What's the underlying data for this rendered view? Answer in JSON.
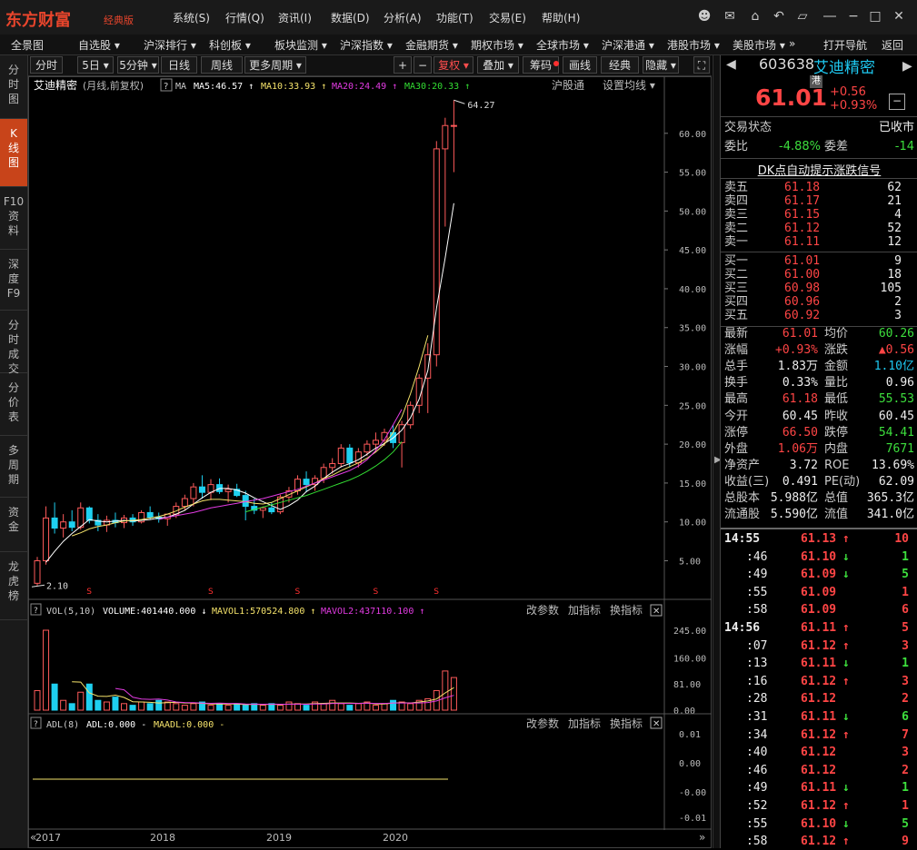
{
  "app": {
    "logo": "东方财富",
    "edition": "经典版",
    "menus": [
      "系统(S)",
      "行情(Q)",
      "资讯(I)",
      "数据(D)",
      "分析(A)",
      "功能(T)",
      "交易(E)",
      "帮助(H)"
    ]
  },
  "nav": {
    "items": [
      "全景图",
      "自选股 ▾",
      "沪深排行 ▾",
      "科创板 ▾",
      "板块监测 ▾",
      "沪深指数 ▾",
      "金融期货 ▾",
      "期权市场 ▾",
      "全球市场 ▾",
      "沪深港通 ▾",
      "港股市场 ▾",
      "美股市场 ▾",
      "»"
    ],
    "right": [
      "打开导航",
      "返回"
    ]
  },
  "left_tabs": [
    "分\n时\n图",
    "K\n线\n图",
    "F10\n资\n料",
    "深\n度\nF9",
    "分\n时\n成\n交",
    "分\n价\n表",
    "多\n周\n期",
    "资\n金",
    "龙\n虎\n榜"
  ],
  "toolbar": {
    "periods": [
      "分时",
      "5日 ▾",
      "5分钟 ▾",
      "日线",
      "周线",
      "更多周期 ▾"
    ],
    "right": [
      "+",
      "−",
      "复权 ▾",
      "叠加 ▾",
      "筹码",
      "画线",
      "经典",
      "隐藏 ▾",
      "⛶"
    ]
  },
  "chart_info": {
    "name": "艾迪精密",
    "mode": "(月线,前复权)",
    "help": "?",
    "ma_label": "MA",
    "ma5": "MA5:46.57",
    "ma10": "MA10:33.93",
    "ma20": "MA20:24.49",
    "ma30": "MA30:20.33",
    "tag": "沪股通",
    "setting": "设置均线 ▾",
    "high_mark": "64.27",
    "low_mark": "2.10",
    "vol_label": "VOL(5,10)",
    "volume": "VOLUME:401440.000",
    "mavol1": "MAVOL1:570524.800",
    "mavol2": "MAVOL2:437110.100",
    "adl_label": "ADL(8)",
    "adl": "ADL:0.000",
    "maadl": "MAADL:0.000",
    "panel_btns": [
      "改参数",
      "加指标",
      "换指标"
    ],
    "x_labels": [
      "2017",
      "2018",
      "2019",
      "2020"
    ],
    "nav_left": "«",
    "nav_right": "»"
  },
  "chart_data": {
    "type": "candlestick",
    "price_ticks": [
      60.0,
      55.0,
      50.0,
      45.0,
      40.0,
      35.0,
      30.0,
      25.0,
      20.0,
      15.0,
      10.0,
      5.0
    ],
    "price_tick_labels": [
      "60.00",
      "55.00",
      "50.00",
      "45.00",
      "40.00",
      "35.00",
      "30.00",
      "25.00",
      "20.00",
      "15.00",
      "10.00",
      "5.00"
    ],
    "ylim": [
      0.5,
      65
    ],
    "candles": [
      [
        2.1,
        5.5,
        1.8,
        5.0
      ],
      [
        5.0,
        12,
        4.5,
        10.5
      ],
      [
        10.5,
        12.5,
        8.5,
        9.2
      ],
      [
        9.2,
        11,
        8.0,
        10.0
      ],
      [
        10.0,
        11.5,
        8.8,
        9.3
      ],
      [
        9.3,
        12.5,
        9.0,
        11.8
      ],
      [
        11.8,
        12.0,
        9.8,
        10.2
      ],
      [
        10.2,
        11.0,
        8.8,
        9.6
      ],
      [
        9.6,
        10.8,
        8.7,
        10.2
      ],
      [
        10.2,
        11.2,
        9.3,
        9.9
      ],
      [
        9.9,
        10.9,
        9.2,
        10.5
      ],
      [
        10.5,
        11.0,
        9.5,
        10.0
      ],
      [
        10.0,
        11.5,
        9.8,
        11.2
      ],
      [
        11.2,
        12.0,
        10.3,
        10.6
      ],
      [
        10.6,
        11.2,
        9.9,
        10.4
      ],
      [
        10.4,
        11.0,
        9.5,
        11.0
      ],
      [
        11.0,
        12.5,
        10.5,
        12.0
      ],
      [
        12.0,
        13.5,
        11.5,
        13.0
      ],
      [
        13.0,
        15.0,
        12.0,
        14.5
      ],
      [
        14.5,
        16.0,
        13.0,
        13.8
      ],
      [
        13.8,
        15.5,
        12.8,
        14.8
      ],
      [
        14.8,
        15.6,
        13.6,
        13.9
      ],
      [
        13.9,
        14.8,
        12.5,
        14.2
      ],
      [
        14.2,
        14.9,
        13.2,
        13.4
      ],
      [
        13.4,
        14.0,
        10.2,
        12.0
      ],
      [
        12.0,
        13.0,
        11.0,
        11.5
      ],
      [
        11.5,
        12.0,
        10.5,
        11.8
      ],
      [
        11.8,
        12.5,
        11.0,
        11.3
      ],
      [
        11.3,
        13.5,
        11.0,
        13.2
      ],
      [
        13.2,
        14.5,
        12.5,
        14.0
      ],
      [
        14.0,
        16.0,
        13.5,
        15.5
      ],
      [
        15.5,
        16.5,
        13.8,
        14.8
      ],
      [
        14.8,
        16.0,
        14.0,
        15.6
      ],
      [
        15.6,
        17.5,
        15.0,
        17.0
      ],
      [
        17.0,
        18.2,
        16.2,
        17.5
      ],
      [
        17.5,
        20.0,
        17.0,
        19.5
      ],
      [
        19.5,
        20.0,
        17.0,
        17.6
      ],
      [
        17.6,
        19.5,
        17.0,
        19.0
      ],
      [
        19.0,
        20.5,
        18.5,
        20.0
      ],
      [
        20.0,
        21.5,
        19.0,
        20.5
      ],
      [
        20.5,
        22.0,
        19.8,
        21.5
      ],
      [
        21.5,
        22.5,
        19.5,
        20.2
      ],
      [
        20.2,
        23.0,
        17.0,
        22.5
      ],
      [
        22.5,
        25.5,
        22.0,
        25.0
      ],
      [
        25.0,
        29.0,
        24.0,
        28.5
      ],
      [
        28.5,
        33.0,
        24.0,
        31.5
      ],
      [
        31.5,
        59.0,
        30.0,
        58.0
      ],
      [
        58.0,
        62.0,
        48.0,
        61.0
      ],
      [
        61.0,
        64.27,
        55.0,
        61.01
      ]
    ],
    "ma_series": [
      {
        "name": "MA5",
        "color": "#ffffff",
        "start": 1,
        "values": [
          4.8,
          6.2,
          7.5,
          8.5,
          9.4,
          10.3,
          10.1,
          10.0,
          10.1,
          10.2,
          10.1,
          10.2,
          10.3,
          10.5,
          10.6,
          11.0,
          11.5,
          12.3,
          13.1,
          13.8,
          14.3,
          14.3,
          14.1,
          13.7,
          13.1,
          12.6,
          12.1,
          11.6,
          12.1,
          12.8,
          13.9,
          14.6,
          15.6,
          16.4,
          17.1,
          17.5,
          18.0,
          18.7,
          19.5,
          20.1,
          20.8,
          21.8,
          23.4,
          25.8,
          29.5,
          37.5,
          44.0,
          51.0
        ]
      },
      {
        "name": "MA10",
        "color": "#f5e36b",
        "start": 4,
        "values": [
          8.2,
          8.6,
          9.1,
          9.4,
          9.6,
          9.9,
          10.1,
          10.2,
          10.3,
          10.5,
          10.7,
          11.0,
          11.4,
          11.9,
          12.3,
          12.7,
          12.9,
          12.9,
          12.8,
          12.7,
          12.6,
          12.4,
          12.3,
          12.5,
          13.0,
          13.5,
          14.0,
          14.5,
          15.0,
          15.6,
          16.0,
          16.6,
          17.1,
          17.6,
          18.2,
          19.0,
          20.0,
          21.5,
          23.5,
          26.5,
          30.0,
          34.0
        ]
      },
      {
        "name": "MA20",
        "color": "#e33be3",
        "start": 14,
        "values": [
          10.3,
          10.6,
          10.8,
          11.0,
          11.2,
          11.5,
          11.8,
          12.0,
          12.2,
          12.4,
          12.6,
          12.8,
          13.0,
          13.3,
          13.6,
          13.9,
          14.2,
          14.6,
          15.0,
          15.4,
          15.8,
          16.2,
          16.6,
          17.2,
          18.0,
          19.2,
          20.6,
          22.5,
          24.49
        ]
      },
      {
        "name": "MA30",
        "color": "#33dd33",
        "start": 24,
        "values": [
          11.3,
          11.6,
          11.9,
          12.2,
          12.5,
          12.8,
          13.1,
          13.4,
          13.8,
          14.2,
          14.6,
          15.0,
          15.4,
          15.9,
          16.5,
          17.2,
          18.0,
          19.0,
          20.33
        ]
      }
    ],
    "vol_ticks": [
      "245.00",
      "160.00",
      "81.00",
      "0.00"
    ],
    "volumes": [
      60,
      245,
      80,
      30,
      20,
      55,
      80,
      30,
      25,
      40,
      20,
      15,
      25,
      20,
      30,
      25,
      20,
      15,
      20,
      25,
      15,
      20,
      15,
      20,
      15,
      20,
      15,
      20,
      15,
      25,
      20,
      15,
      25,
      20,
      30,
      20,
      15,
      20,
      25,
      15,
      20,
      30,
      25,
      20,
      30,
      35,
      60,
      120,
      100
    ],
    "adl_ticks": [
      "0.01",
      "0.00",
      "-0.00",
      "-0.01"
    ]
  },
  "quote": {
    "code": "603638",
    "name": "艾迪精密",
    "price": "61.01",
    "market_tag": "港",
    "change": "+0.56",
    "change_pct": "+0.93%",
    "status_label": "交易状态",
    "status_value": "已收市",
    "weibi_label": "委比",
    "weibi_value": "-4.88%",
    "weicha_label": "委差",
    "weicha_value": "-14",
    "signal": "DK点自动提示涨跌信号",
    "asks": [
      {
        "label": "卖五",
        "price": "61.18",
        "vol": "62"
      },
      {
        "label": "卖四",
        "price": "61.17",
        "vol": "21"
      },
      {
        "label": "卖三",
        "price": "61.15",
        "vol": "4"
      },
      {
        "label": "卖二",
        "price": "61.12",
        "vol": "52"
      },
      {
        "label": "卖一",
        "price": "61.11",
        "vol": "12"
      }
    ],
    "bids": [
      {
        "label": "买一",
        "price": "61.01",
        "vol": "9"
      },
      {
        "label": "买二",
        "price": "61.00",
        "vol": "18"
      },
      {
        "label": "买三",
        "price": "60.98",
        "vol": "105"
      },
      {
        "label": "买四",
        "price": "60.96",
        "vol": "2"
      },
      {
        "label": "买五",
        "price": "60.92",
        "vol": "3"
      }
    ],
    "stats": [
      {
        "l1": "最新",
        "v1": "61.01",
        "c1": "red",
        "l2": "均价",
        "v2": "60.26",
        "c2": "green"
      },
      {
        "l1": "涨幅",
        "v1": "+0.93%",
        "c1": "red",
        "l2": "涨跌",
        "v2": "▲0.56",
        "c2": "red"
      },
      {
        "l1": "总手",
        "v1": "1.83万",
        "c1": "white",
        "l2": "金额",
        "v2": "1.10亿",
        "c2": "cyan"
      },
      {
        "l1": "换手",
        "v1": "0.33%",
        "c1": "white",
        "l2": "量比",
        "v2": "0.96",
        "c2": "white"
      },
      {
        "l1": "最高",
        "v1": "61.18",
        "c1": "red",
        "l2": "最低",
        "v2": "55.53",
        "c2": "green"
      },
      {
        "l1": "今开",
        "v1": "60.45",
        "c1": "white",
        "l2": "昨收",
        "v2": "60.45",
        "c2": "white"
      },
      {
        "l1": "涨停",
        "v1": "66.50",
        "c1": "red",
        "l2": "跌停",
        "v2": "54.41",
        "c2": "green"
      },
      {
        "l1": "外盘",
        "v1": "1.06万",
        "c1": "red",
        "l2": "内盘",
        "v2": "7671",
        "c2": "green"
      },
      {
        "l1": "净资产",
        "v1": "3.72",
        "c1": "white",
        "l2": "ROE",
        "v2": "13.69%",
        "c2": "white"
      },
      {
        "l1": "收益(三)",
        "v1": "0.491",
        "c1": "white",
        "l2": "PE(动)",
        "v2": "62.09",
        "c2": "white"
      },
      {
        "l1": "总股本",
        "v1": "5.988亿",
        "c1": "white",
        "l2": "总值",
        "v2": "365.3亿",
        "c2": "white"
      },
      {
        "l1": "流通股",
        "v1": "5.590亿",
        "c1": "white",
        "l2": "流值",
        "v2": "341.0亿",
        "c2": "white"
      }
    ],
    "ticks": [
      {
        "t": "14:55",
        "p": "61.13",
        "a": "↑",
        "ac": "red",
        "v": "10",
        "vc": "red",
        "bold": true
      },
      {
        "t": ":46",
        "p": "61.10",
        "a": "↓",
        "ac": "green",
        "v": "1",
        "vc": "green"
      },
      {
        "t": ":49",
        "p": "61.09",
        "a": "↓",
        "ac": "green",
        "v": "5",
        "vc": "green"
      },
      {
        "t": ":55",
        "p": "61.09",
        "a": "",
        "ac": "red",
        "v": "1",
        "vc": "red"
      },
      {
        "t": ":58",
        "p": "61.09",
        "a": "",
        "ac": "red",
        "v": "6",
        "vc": "red"
      },
      {
        "t": "14:56",
        "p": "61.11",
        "a": "↑",
        "ac": "red",
        "v": "5",
        "vc": "red",
        "bold": true
      },
      {
        "t": ":07",
        "p": "61.12",
        "a": "↑",
        "ac": "red",
        "v": "3",
        "vc": "red"
      },
      {
        "t": ":13",
        "p": "61.11",
        "a": "↓",
        "ac": "green",
        "v": "1",
        "vc": "green"
      },
      {
        "t": ":16",
        "p": "61.12",
        "a": "↑",
        "ac": "red",
        "v": "3",
        "vc": "red"
      },
      {
        "t": ":28",
        "p": "61.12",
        "a": "",
        "ac": "red",
        "v": "2",
        "vc": "red"
      },
      {
        "t": ":31",
        "p": "61.11",
        "a": "↓",
        "ac": "green",
        "v": "6",
        "vc": "green"
      },
      {
        "t": ":34",
        "p": "61.12",
        "a": "↑",
        "ac": "red",
        "v": "7",
        "vc": "red"
      },
      {
        "t": ":40",
        "p": "61.12",
        "a": "",
        "ac": "red",
        "v": "3",
        "vc": "red"
      },
      {
        "t": ":46",
        "p": "61.12",
        "a": "",
        "ac": "red",
        "v": "2",
        "vc": "red"
      },
      {
        "t": ":49",
        "p": "61.11",
        "a": "↓",
        "ac": "green",
        "v": "1",
        "vc": "green"
      },
      {
        "t": ":52",
        "p": "61.12",
        "a": "↑",
        "ac": "red",
        "v": "1",
        "vc": "red"
      },
      {
        "t": ":55",
        "p": "61.10",
        "a": "↓",
        "ac": "green",
        "v": "5",
        "vc": "green"
      },
      {
        "t": ":58",
        "p": "61.12",
        "a": "↑",
        "ac": "red",
        "v": "9",
        "vc": "red"
      }
    ]
  }
}
